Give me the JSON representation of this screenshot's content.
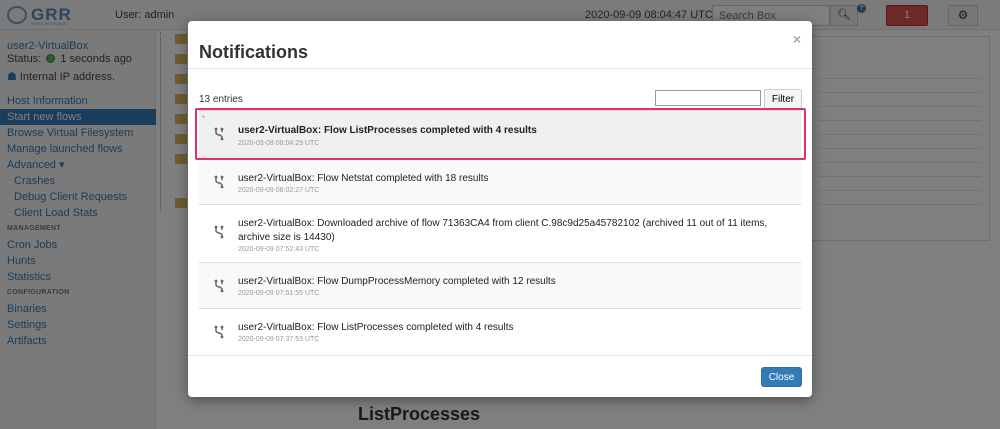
{
  "header": {
    "logo_text": "GRR",
    "logo_sub": "RAPID RESPONSE",
    "user_label": "User: admin",
    "time": "2020-09-09 08:04:47 UTC",
    "search_placeholder": "Search Box",
    "notification_count": "1"
  },
  "client": {
    "name": "user2-VirtualBox",
    "status_prefix": "Status:",
    "status_text": "1 seconds ago",
    "ip_text": "Internal IP address."
  },
  "sidebar": {
    "host_info": "Host Information",
    "start_flows": "Start new flows",
    "browse_vfs": "Browse Virtual Filesystem",
    "manage_flows": "Manage launched flows",
    "advanced": "Advanced ▾",
    "crashes": "Crashes",
    "debug_requests": "Debug Client Requests",
    "load_stats": "Client Load Stats",
    "management_head": "MANAGEMENT",
    "cron_jobs": "Cron Jobs",
    "hunts": "Hunts",
    "statistics": "Statistics",
    "configuration_head": "CONFIGURATION",
    "binaries": "Binaries",
    "settings": "Settings",
    "artifacts": "Artifacts"
  },
  "main": {
    "title": "ListProcesses"
  },
  "modal": {
    "title": "Notifications",
    "close_symbol": "×",
    "entries": "13 entries",
    "filter_value": "",
    "filter_button": "Filter",
    "close_button": "Close",
    "new_marker": "*",
    "notifications": [
      {
        "message": "user2-VirtualBox: Flow ListProcesses completed with 4 results",
        "time": "2020-09-09 08:04:29 UTC"
      },
      {
        "message": "user2-VirtualBox: Flow Netstat completed with 18 results",
        "time": "2020-09-09 08:02:27 UTC"
      },
      {
        "message": "user2-VirtualBox: Downloaded archive of flow 71363CA4 from client C.98c9d25a45782102 (archived 11 out of 11 items, archive size is 14430)",
        "time": "2020-09-09 07:52:43 UTC"
      },
      {
        "message": "user2-VirtualBox: Flow DumpProcessMemory completed with 12 results",
        "time": "2020-09-09 07:51:55 UTC"
      },
      {
        "message": "user2-VirtualBox: Flow ListProcesses completed with 4 results",
        "time": "2020-09-09 07:37:53 UTC"
      }
    ]
  }
}
